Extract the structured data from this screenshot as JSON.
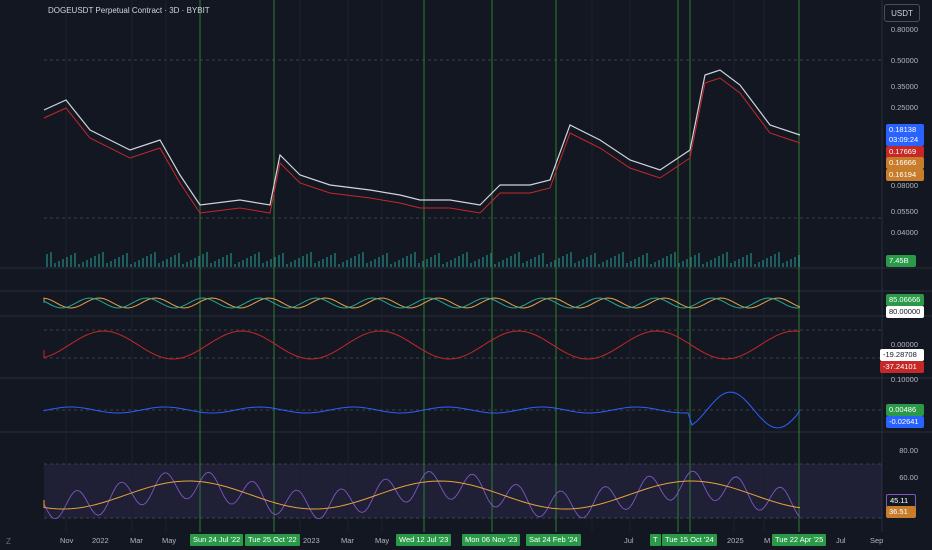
{
  "header": {
    "title": "DOGEUSDT Perpetual Contract · 3D · BYBIT",
    "currency_button": "USDT"
  },
  "price_axis": {
    "ticks": [
      "0.80000",
      "0.50000",
      "0.35000",
      "0.25000",
      "0.08000",
      "0.05500",
      "0.04000"
    ]
  },
  "price_badges": {
    "last": "0.18138",
    "countdown": "03:09:24",
    "ma_fast": "0.17669",
    "level_a": "0.16666",
    "level_b": "0.16194",
    "volume": "7.45B"
  },
  "stoch": {
    "value": "85.06666",
    "upper": "80.00000"
  },
  "osc1": {
    "axis_top": "0.00000",
    "value_a": "-19.28708",
    "value_b": "-37.24101"
  },
  "osc2": {
    "axis_top": "0.10000",
    "value_a": "0.00486",
    "value_b": "-0.02641"
  },
  "rsi": {
    "ticks": [
      "80.00",
      "60.00"
    ],
    "value_a": "45.11",
    "value_b": "36.51"
  },
  "time_axis": {
    "labels": [
      "Nov",
      "2022",
      "Mar",
      "May",
      "2023",
      "Mar",
      "May",
      "Jul",
      "Jul",
      "2025",
      "Jul",
      "Sep"
    ],
    "date_tags": [
      "Sun 24 Jul '22",
      "Tue 25 Oct '22",
      "Wed 12 Jul '23",
      "Mon 06 Nov '23",
      "Sat 24 Feb '24",
      "Tue 15 Oct '24",
      "Tue 22 Apr '25"
    ],
    "partial_tags": [
      "T",
      "M"
    ]
  },
  "corner": {
    "left_icon": "Z"
  },
  "colors": {
    "background": "#131722",
    "green_line": "#2e7d32",
    "red_ma": "#c62828",
    "blue_ma": "#2962ff",
    "orange": "#e8a33d",
    "purple": "#7e57c2"
  }
}
